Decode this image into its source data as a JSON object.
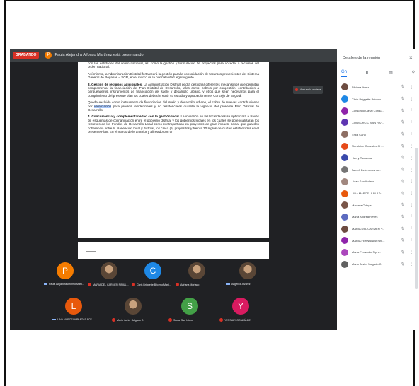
{
  "meeting": {
    "recording_label": "GRABANDO",
    "presenter_initial": "P",
    "presenter_text": "Paula Alejandra Alfonso Martínez está presentando"
  },
  "document": {
    "paragraphs": [
      {
        "text": "con las entidades del orden nacional, así como la gestión y formulación de proyectos para acceder a recursos del orden nacional."
      },
      {
        "text": "Así mismo, la Administración Distrital fortalecerá la gestión para la consolidación de recursos provenientes del Sistema General de Regalías – SGR, en el marco de la normatividad legal vigente."
      },
      {
        "bold": "3. Gestión de recursos adicionales.",
        "text": " La Administración Distrital podrá gestionar diferentes mecanismos que permitan complementar la financiación del Plan Distrital de Desarrollo, tales como: cobros por congestión, contribución a parqueaderos, instrumentos de financiación del suelo y desarrollo urbano, y otros que sean necesarios para el cumplimiento del presente plan los cuales deberán surtir su estudio y aprobación en el Concejo de Bogotá."
      },
      {
        "text_a": "Queda excluido como instrumento de financiación del suelo y desarrollo urbano, el cobro de nuevas contribuciones por ",
        "highlight": "valorización",
        "text_b": " para predios residenciales y no residenciales durante la vigencia del presente Plan Distrital de Desarrollo."
      },
      {
        "bold": "4. Concurrencia y complementariedad con la gestión local.",
        "text": " La inversión en las localidades se optimizará a través de esquemas de cofinanciación entre el gobierno distrital y los gobiernos locales en los cuales se potencializarán los recursos de los Fondos de Desarrollo Local como contrapartidas en proyectos de gran impacto social que guarden coherencia entre la planeación local y distrital, los cinco (5) propósitos y treinta 30 logros de ciudad establecidos en el presente Plan. En el marco de lo anterior y alineado con un"
      }
    ],
    "mini_label": "Abrir en la ventana"
  },
  "tiles": [
    {
      "initial": "P",
      "color": "#f57c00",
      "name": "Paula Alejandra Alfonso Marti...",
      "type": "letter",
      "status": "pin"
    },
    {
      "initial": "",
      "color": "",
      "name": "MARIA DEL CARMEN PINILL...",
      "type": "photo",
      "status": "mic"
    },
    {
      "initial": "C",
      "color": "#1e88e5",
      "name": "Chris Briggette Briceno Marti...",
      "type": "letter",
      "status": "mic"
    },
    {
      "initial": "",
      "color": "",
      "name": "Adriana Moriano",
      "type": "photo",
      "status": "mic"
    },
    {
      "initial": "",
      "color": "",
      "name": "Angelica Alvarez",
      "type": "photo",
      "status": "pin"
    },
    {
      "initial": "L",
      "color": "#e8590c",
      "name": "LINA MARCELA PLAZAS ACE...",
      "type": "letter",
      "status": "pin"
    },
    {
      "initial": "",
      "color": "",
      "name": "Mario Javier Salgado C.",
      "type": "photo",
      "status": "mic"
    },
    {
      "initial": "S",
      "color": "#43a047",
      "name": "Social San Isidro",
      "type": "letter",
      "status": "mic"
    },
    {
      "initial": "Y",
      "color": "#d81b60",
      "name": "YESSULY GONZÁLEZ",
      "type": "letter",
      "status": "mic"
    }
  ],
  "panel": {
    "title": "Detalles de la reunión",
    "close": "×",
    "tabs": [
      "Gh",
      "◧",
      "▤",
      "⚲"
    ],
    "participants": [
      {
        "name": "Bibiana Ibarra",
        "color": "#6d4c41"
      },
      {
        "name": "Chris Briggette Briceno...",
        "color": "#1e88e5"
      },
      {
        "name": "Consorcio Canal Conda...",
        "color": "#8e24aa"
      },
      {
        "name": "CONSORCIO SAN RAF...",
        "color": "#5e35b1"
      },
      {
        "name": "Erika Cano",
        "color": "#8d6e63"
      },
      {
        "name": "Geraldine Gonzalez Ch...",
        "color": "#e64a19"
      },
      {
        "name": "Henry Tarazona",
        "color": "#3949ab"
      },
      {
        "name": "Jainoff Defensores ru...",
        "color": "#757575"
      },
      {
        "name": "Licao San Andrés",
        "color": "#a1887f"
      },
      {
        "name": "LINA MARCELA PLAZA...",
        "color": "#e8590c"
      },
      {
        "name": "Marcela Ortega",
        "color": "#795548"
      },
      {
        "name": "María Andrea Reyes",
        "color": "#5c6bc0"
      },
      {
        "name": "MARIA DEL CARMEN P...",
        "color": "#6d4c41"
      },
      {
        "name": "MARIA FERNANDA PAT...",
        "color": "#8e24aa"
      },
      {
        "name": "María Fernanda Piphr...",
        "color": "#ab47bc"
      },
      {
        "name": "Mario Javier Salgado C.",
        "color": "#616161"
      }
    ],
    "mic_icon": "🎙",
    "more_icon": "⋮"
  }
}
